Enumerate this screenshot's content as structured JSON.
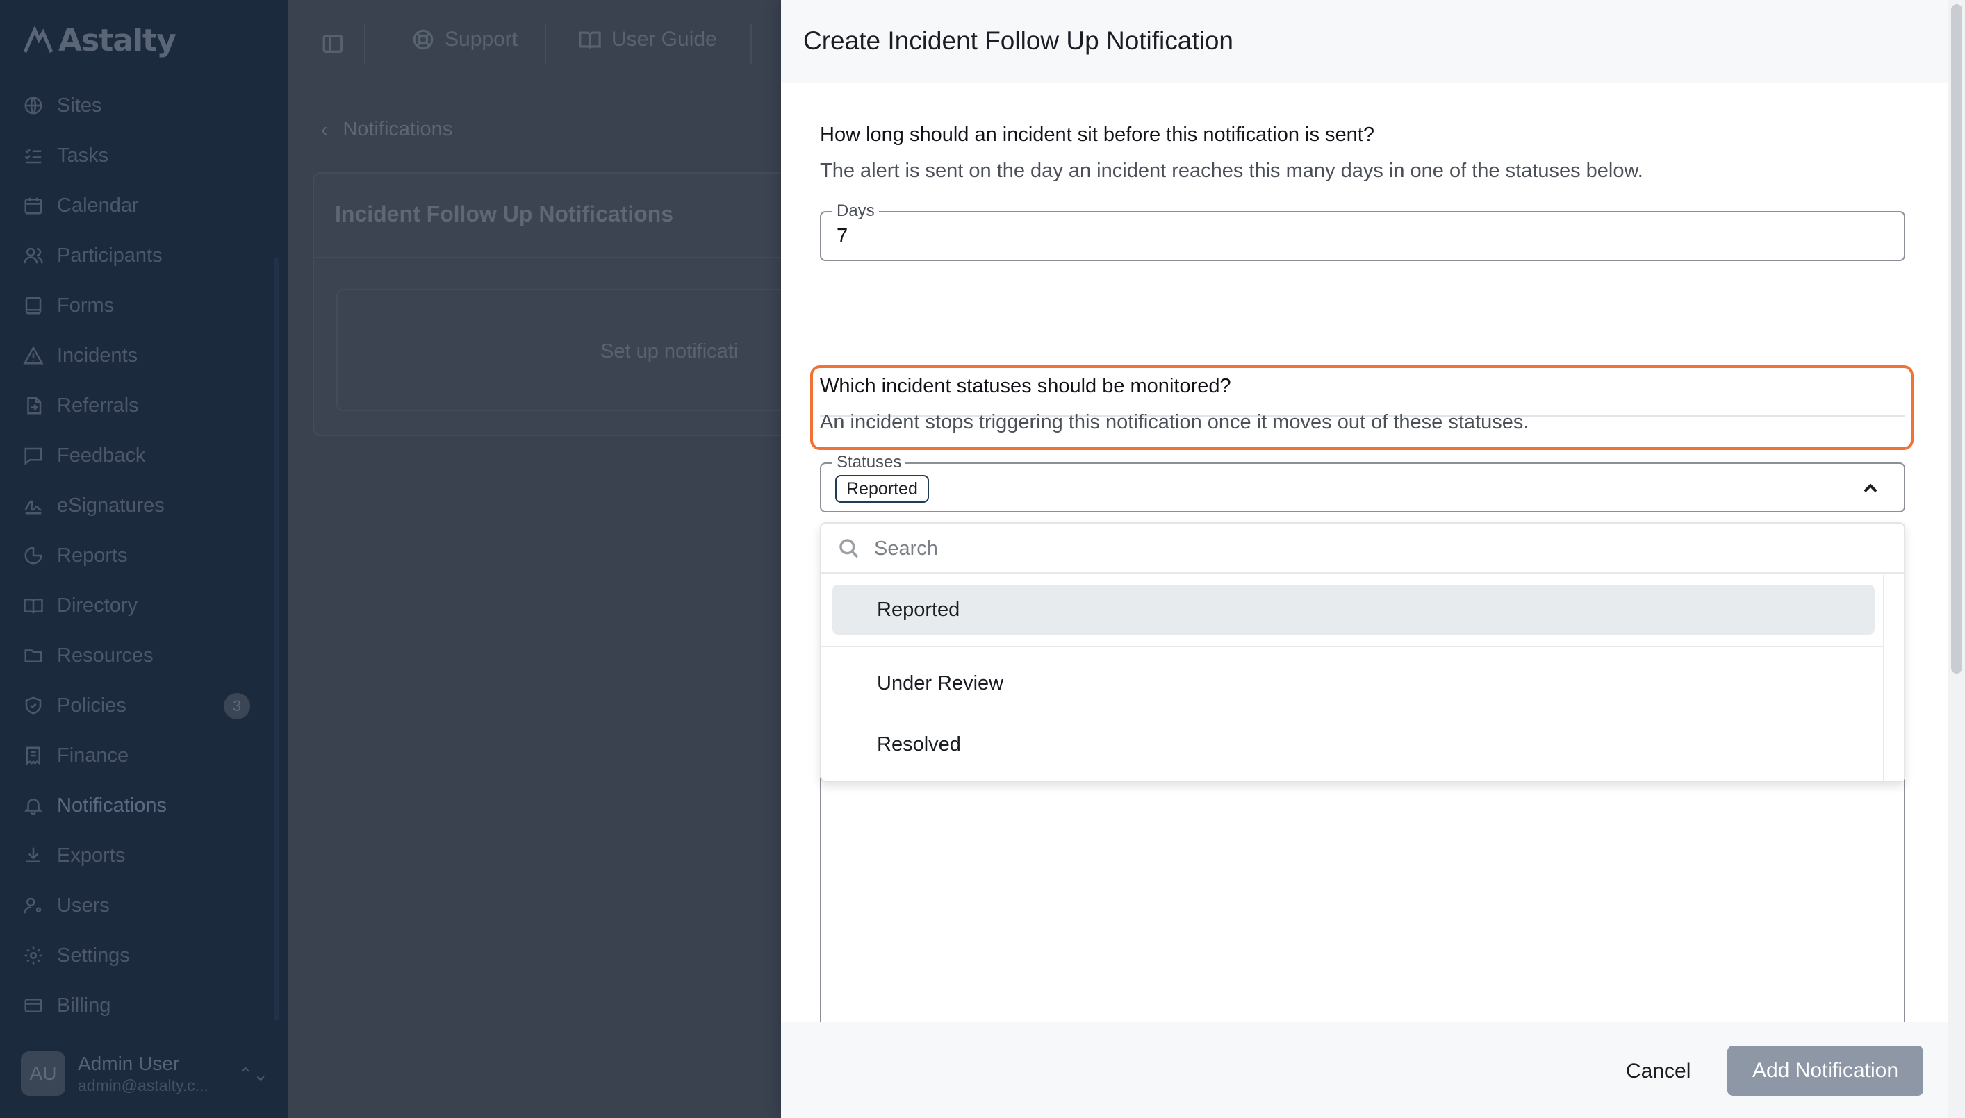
{
  "app": {
    "logo_text": "Astalty"
  },
  "sidebar": {
    "items": [
      {
        "label": "Sites",
        "icon": "globe-icon"
      },
      {
        "label": "Tasks",
        "icon": "list-checks-icon"
      },
      {
        "label": "Calendar",
        "icon": "calendar-icon"
      },
      {
        "label": "Participants",
        "icon": "users-icon"
      },
      {
        "label": "Forms",
        "icon": "form-icon"
      },
      {
        "label": "Incidents",
        "icon": "warning-triangle-icon"
      },
      {
        "label": "Referrals",
        "icon": "file-arrow-icon"
      },
      {
        "label": "Feedback",
        "icon": "message-square-icon"
      },
      {
        "label": "eSignatures",
        "icon": "signature-icon"
      },
      {
        "label": "Reports",
        "icon": "pie-chart-icon"
      },
      {
        "label": "Directory",
        "icon": "book-open-icon"
      },
      {
        "label": "Resources",
        "icon": "folder-icon"
      },
      {
        "label": "Policies",
        "icon": "shield-icon",
        "badge": "3"
      },
      {
        "label": "Finance",
        "icon": "receipt-icon"
      },
      {
        "label": "Notifications",
        "icon": "bell-icon"
      },
      {
        "label": "Exports",
        "icon": "download-icon"
      },
      {
        "label": "Users",
        "icon": "user-cog-icon"
      },
      {
        "label": "Settings",
        "icon": "gear-icon"
      },
      {
        "label": "Billing",
        "icon": "credit-card-icon"
      }
    ],
    "user": {
      "initials": "AU",
      "name": "Admin User",
      "email": "admin@astalty.c..."
    }
  },
  "topbar": {
    "support_label": "Support",
    "guide_label": "User Guide"
  },
  "page": {
    "breadcrumb": "Notifications",
    "card_title": "Incident Follow Up Notifications",
    "card_empty_text": "Set up notificati"
  },
  "drawer": {
    "title": "Create Incident Follow Up Notification",
    "days_question": "How long should an incident sit before this notification is sent?",
    "days_description": "The alert is sent on the day an incident reaches this many days in one of the statuses below.",
    "days_label": "Days",
    "days_value": "7",
    "status_question": "Which incident statuses should be monitored?",
    "status_description": "An incident stops triggering this notification once it moves out of these statuses.",
    "statuses_label": "Statuses",
    "selected_chip": "Reported",
    "search_placeholder": "Search",
    "options": [
      "Reported",
      "Under Review",
      "Resolved"
    ],
    "cancel_label": "Cancel",
    "add_label": "Add Notification"
  },
  "colors": {
    "focus_ring": "#f07335",
    "sidebar_bg": "#1c2a3d",
    "primary_button": "#8e97a6"
  }
}
